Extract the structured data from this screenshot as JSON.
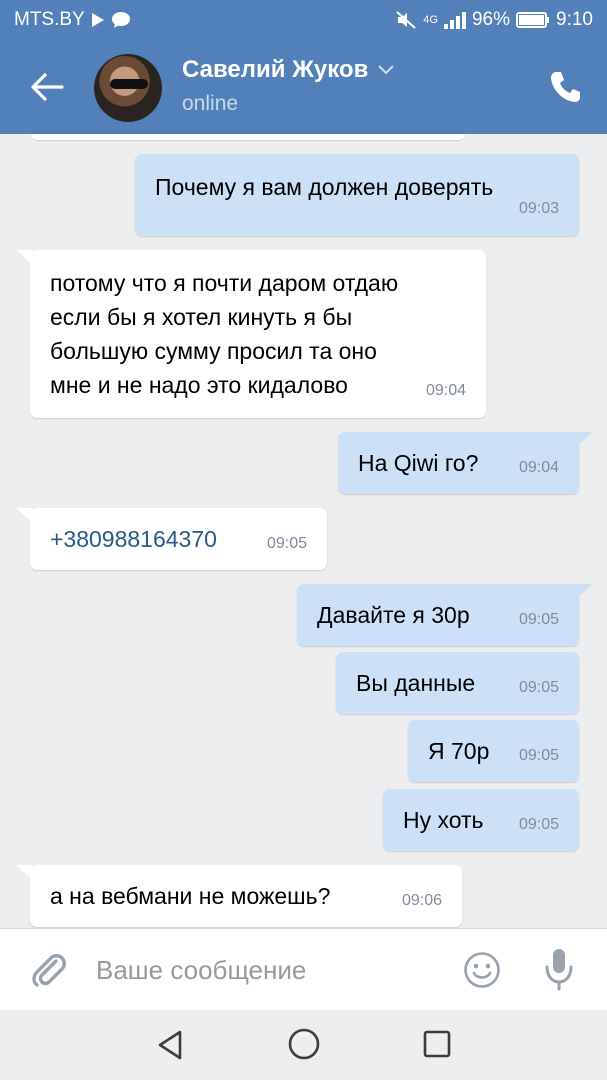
{
  "status_bar": {
    "carrier": "MTS.BY",
    "network": "4G",
    "battery": "96%",
    "time": "9:10"
  },
  "header": {
    "contact_name": "Савелий Жуков",
    "contact_status": "online"
  },
  "messages": [
    {
      "dir": "out",
      "text": "Почему я вам должен доверять",
      "time": "09:03"
    },
    {
      "dir": "in",
      "text": "потому что я почти даром отдаю\nесли бы я хотел кинуть я бы\nбольшую сумму просил та оно\nмне и не надо это кидалово",
      "time": "09:04"
    },
    {
      "dir": "out",
      "text": "На Qiwi го?",
      "time": "09:04"
    },
    {
      "dir": "in",
      "text": "+380988164370",
      "time": "09:05"
    },
    {
      "dir": "out",
      "text": "Давайте я 30р",
      "time": "09:05"
    },
    {
      "dir": "out",
      "text": "Вы данные",
      "time": "09:05"
    },
    {
      "dir": "out",
      "text": "Я 70р",
      "time": "09:05"
    },
    {
      "dir": "out",
      "text": "Ну хоть",
      "time": "09:05"
    },
    {
      "dir": "in",
      "text": "а на вебмани не можешь?",
      "time": "09:06"
    }
  ],
  "composer": {
    "placeholder": "Ваше сообщение"
  },
  "colors": {
    "header": "#5181b8",
    "outgoing_bubble": "#cce1f8",
    "incoming_bubble": "#ffffff",
    "background": "#edeef0",
    "link": "#2a5885"
  },
  "icons": [
    "back-arrow-icon",
    "chevron-down-icon",
    "phone-icon",
    "paperclip-icon",
    "smile-icon",
    "microphone-icon",
    "nav-back-icon",
    "nav-home-icon",
    "nav-recents-icon"
  ]
}
